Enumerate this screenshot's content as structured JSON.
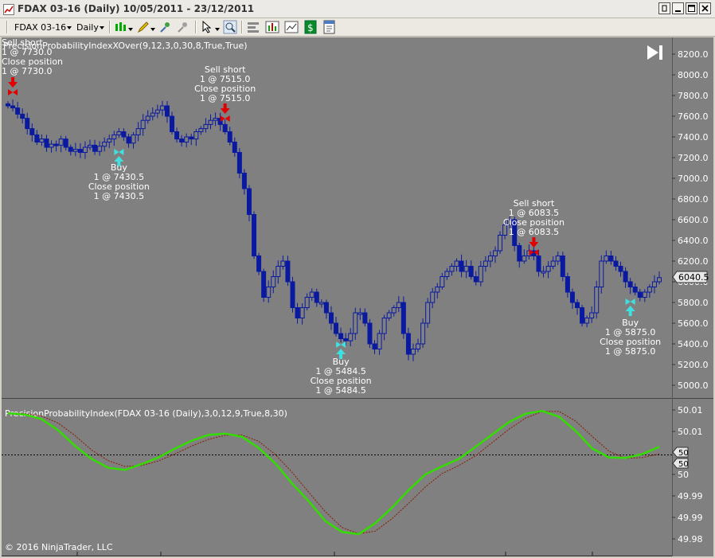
{
  "window": {
    "title": "FDAX 03-16 (Daily)  10/05/2011 - 23/12/2011"
  },
  "toolbar": {
    "instrument": "FDAX 03-16",
    "period": "Daily"
  },
  "price_panel": {
    "indicator_label": "PrecisionProbabilityIndexXOver(9,12,3,0,30,8,True,True)",
    "axis_ticks": [
      "8200.0",
      "8000.0",
      "7800.0",
      "7600.0",
      "7400.0",
      "7200.0",
      "7000.0",
      "6800.0",
      "6600.0",
      "6400.0",
      "6200.0",
      "6000.0",
      "5800.0",
      "5600.0",
      "5400.0",
      "5200.0",
      "5000.0"
    ],
    "last_price": "6040.5",
    "signals": [
      {
        "lines": [
          "Sell short",
          "1 @ 7730.0",
          "Close position",
          "1 @ 7730.0"
        ],
        "type": "sell"
      },
      {
        "lines": [
          "Buy",
          "1 @ 7430.5",
          "Close position",
          "1 @ 7430.5"
        ],
        "type": "buy"
      },
      {
        "lines": [
          "Sell short",
          "1 @ 7515.0",
          "Close position",
          "1 @ 7515.0"
        ],
        "type": "sell"
      },
      {
        "lines": [
          "Buy",
          "1 @ 5484.5",
          "Close position",
          "1 @ 5484.5"
        ],
        "type": "buy"
      },
      {
        "lines": [
          "Sell short",
          "1 @ 6083.5",
          "Close position",
          "1 @ 6083.5"
        ],
        "type": "sell"
      },
      {
        "lines": [
          "Buy",
          "1 @ 5875.0",
          "Close position",
          "1 @ 5875.0"
        ],
        "type": "buy"
      }
    ]
  },
  "indicator_panel": {
    "label": "PrecisionProbabilityIndex(FDAX 03-16 (Daily),3,0,12,9,True,8,30)",
    "axis_ticks": [
      "50.01",
      "50.01",
      "50",
      "49.99",
      "49.99",
      "49.98"
    ],
    "last_values": [
      "50",
      "50"
    ]
  },
  "copyright": "© 2016 NinjaTrader, LLC",
  "colors": {
    "background": "#808080",
    "candle": "#0a1aa0",
    "sell_arrow": "#e00000",
    "buy_arrow": "#40e0e0",
    "fast_line": "#33dd00",
    "slow_line": "#8b1a00"
  },
  "chart_data": {
    "type": "candlestick",
    "x_range": [
      "10/05/2011",
      "23/12/2011"
    ],
    "y_range": [
      5000,
      8200
    ],
    "close_path": [
      7700,
      7680,
      7620,
      7580,
      7480,
      7420,
      7350,
      7380,
      7300,
      7330,
      7320,
      7380,
      7300,
      7260,
      7280,
      7250,
      7300,
      7320,
      7260,
      7310,
      7350,
      7380,
      7420,
      7450,
      7400,
      7340,
      7420,
      7480,
      7560,
      7600,
      7630,
      7660,
      7700,
      7600,
      7450,
      7380,
      7350,
      7400,
      7380,
      7450,
      7480,
      7520,
      7560,
      7580,
      7520,
      7450,
      7350,
      7250,
      7050,
      6900,
      6650,
      6250,
      6100,
      5850,
      5950,
      6050,
      6150,
      6200,
      6000,
      5750,
      5650,
      5750,
      5850,
      5900,
      5800,
      5800,
      5700,
      5600,
      5500,
      5450,
      5430,
      5500,
      5700,
      5700,
      5600,
      5400,
      5350,
      5500,
      5650,
      5700,
      5750,
      5800,
      5500,
      5300,
      5350,
      5400,
      5600,
      5800,
      5900,
      5950,
      6050,
      6100,
      6150,
      6200,
      6100,
      6150,
      6050,
      6000,
      6150,
      6200,
      6250,
      6300,
      6450,
      6550,
      6600,
      6350,
      6200,
      6250,
      6300,
      6250,
      6100,
      6100,
      6150,
      6200,
      6250,
      6050,
      5900,
      5800,
      5750,
      5600,
      5650,
      5700,
      5950,
      6200,
      6250,
      6200,
      6150,
      6100,
      6000,
      5950,
      5900,
      5850,
      5900,
      5950,
      6000,
      6040
    ],
    "indicator_range": [
      49.98,
      50.01
    ],
    "series": [
      {
        "name": "fast",
        "values": [
          50.0098,
          50.0095,
          50.0085,
          50.006,
          50.0025,
          49.9995,
          49.9975,
          49.997,
          49.9983,
          49.9998,
          50.0018,
          50.0036,
          50.0049,
          50.0052,
          50.0045,
          50.002,
          49.9985,
          49.994,
          49.99,
          49.9855,
          49.983,
          49.9825,
          49.985,
          49.9885,
          49.9925,
          49.996,
          49.9978,
          49.9995,
          50.0022,
          50.005,
          50.0078,
          50.0097,
          50.0103,
          50.009,
          50.0058,
          50.0018,
          49.9998,
          49.9997,
          50.0006,
          50.0022
        ]
      },
      {
        "name": "slow",
        "values": [
          50.0099,
          50.0097,
          50.0092,
          50.0076,
          50.0048,
          50.0015,
          49.9991,
          49.9978,
          49.998,
          49.999,
          50.0006,
          50.0024,
          50.0039,
          50.0048,
          50.0049,
          50.0035,
          50.0005,
          49.9965,
          49.992,
          49.9876,
          49.984,
          49.9826,
          49.9832,
          49.986,
          49.9895,
          49.9932,
          49.9962,
          49.998,
          50.0002,
          50.0032,
          50.0062,
          50.0087,
          50.0102,
          50.0102,
          50.008,
          50.0045,
          50.0012,
          49.9996,
          49.9998,
          50.0006
        ]
      }
    ]
  }
}
